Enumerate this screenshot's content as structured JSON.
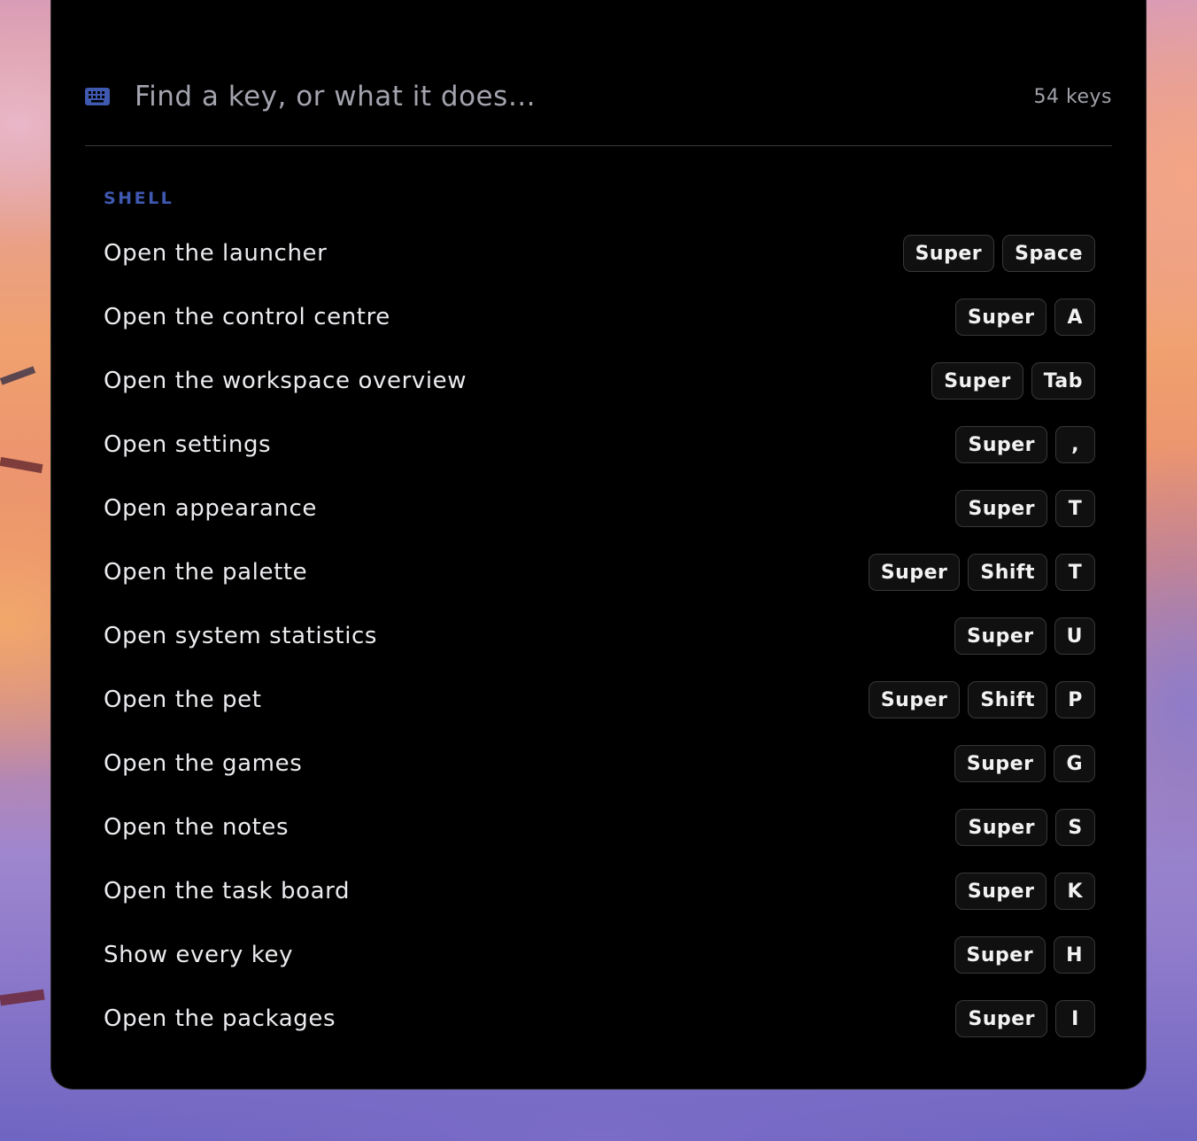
{
  "search": {
    "placeholder": "Find a key, or what it does…",
    "value": "",
    "count_label": "54 keys",
    "icon": "keyboard-icon"
  },
  "colors": {
    "accent": "#3f58b0",
    "panel_background": "#000000",
    "key_background": "#101010"
  },
  "sections": [
    {
      "title": "SHELL",
      "items": [
        {
          "label": "Open the launcher",
          "keys": [
            "Super",
            "Space"
          ]
        },
        {
          "label": "Open the control centre",
          "keys": [
            "Super",
            "A"
          ]
        },
        {
          "label": "Open the workspace overview",
          "keys": [
            "Super",
            "Tab"
          ]
        },
        {
          "label": "Open settings",
          "keys": [
            "Super",
            ","
          ]
        },
        {
          "label": "Open appearance",
          "keys": [
            "Super",
            "T"
          ]
        },
        {
          "label": "Open the palette",
          "keys": [
            "Super",
            "Shift",
            "T"
          ]
        },
        {
          "label": "Open system statistics",
          "keys": [
            "Super",
            "U"
          ]
        },
        {
          "label": "Open the pet",
          "keys": [
            "Super",
            "Shift",
            "P"
          ]
        },
        {
          "label": "Open the games",
          "keys": [
            "Super",
            "G"
          ]
        },
        {
          "label": "Open the notes",
          "keys": [
            "Super",
            "S"
          ]
        },
        {
          "label": "Open the task board",
          "keys": [
            "Super",
            "K"
          ]
        },
        {
          "label": "Show every key",
          "keys": [
            "Super",
            "H"
          ]
        },
        {
          "label": "Open the packages",
          "keys": [
            "Super",
            "I"
          ]
        }
      ]
    }
  ]
}
